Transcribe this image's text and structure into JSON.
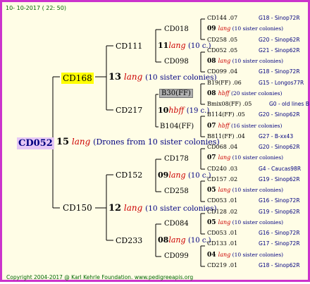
{
  "date": "10- 10-2017 ( 22: 50)",
  "footer": "Copyright 2004-2017 @ Karl Kehrle Foundation.   www.pedigreeapis.org",
  "root": {
    "name": "CD052",
    "num": "15",
    "lang": "lang",
    "info": "(Drones from 10 sister colonies)"
  },
  "gen1": [
    {
      "name": "CD168",
      "num": "13",
      "lang": "lang",
      "info": "(10 sister colonies)"
    },
    {
      "name": "CD150",
      "num": "12",
      "lang": "lang",
      "info": "(10 sister colonies)"
    }
  ],
  "gen2": [
    {
      "name": "CD111",
      "num": "11",
      "lang": "lang",
      "info": "(10 c.)"
    },
    {
      "name": "CD217",
      "num": "10",
      "lang": "hbff",
      "info": "(19 c.)"
    },
    {
      "name": "CD152",
      "num": "09",
      "lang": "lang",
      "info": "(10 c.)"
    },
    {
      "name": "CD233",
      "num": "08",
      "lang": "lang",
      "info": "(10 c.)"
    }
  ],
  "gen3": [
    {
      "name": "CD018"
    },
    {
      "name": "CD098"
    },
    {
      "name": "B30(FF)"
    },
    {
      "name": "B104(FF)"
    },
    {
      "name": "CD178"
    },
    {
      "name": "CD258"
    },
    {
      "name": "CD084"
    },
    {
      "name": "CD099"
    }
  ],
  "gen4": [
    {
      "type": "line",
      "name": "CD144",
      "num": ".07",
      "ref": "G18 - Sinop72R"
    },
    {
      "type": "note",
      "num": "09",
      "lang": "lang",
      "info": "(10 sister colonies)"
    },
    {
      "type": "line",
      "name": "CD258",
      "num": ".05",
      "ref": "G20 - Sinop62R"
    },
    {
      "type": "line",
      "name": "CD052",
      "num": ".05",
      "ref": "G21 - Sinop62R"
    },
    {
      "type": "note",
      "num": "08",
      "lang": "lang",
      "info": "(10 sister colonies)"
    },
    {
      "type": "line",
      "name": "CD099",
      "num": ".04",
      "ref": "G18 - Sinop72R"
    },
    {
      "type": "line",
      "name": "B19(FF)",
      "num": ".06",
      "ref": "G15 - Longos77R"
    },
    {
      "type": "note",
      "num": "08",
      "lang": "hbff",
      "info": "(20 sister colonies)"
    },
    {
      "type": "line",
      "name": "Bmix08(FF)",
      "num": ".05",
      "ref": "G0 - old lines B"
    },
    {
      "type": "line",
      "name": "B114(FF)",
      "num": ".05",
      "ref": "G20 - Sinop62R"
    },
    {
      "type": "note",
      "num": "07",
      "lang": "hbff",
      "info": "(16 sister colonies)"
    },
    {
      "type": "line",
      "name": "B811(FF)",
      "num": ".04",
      "ref": "G27 - B-xx43"
    },
    {
      "type": "line",
      "name": "CD068",
      "num": ".04",
      "ref": "G20 - Sinop62R"
    },
    {
      "type": "note",
      "num": "07",
      "lang": "lang",
      "info": "(10 sister colonies)"
    },
    {
      "type": "line",
      "name": "CD240",
      "num": ".03",
      "ref": "G4 - Caucas98R"
    },
    {
      "type": "line",
      "name": "CD157",
      "num": ".02",
      "ref": "G19 - Sinop62R"
    },
    {
      "type": "note",
      "num": "05",
      "lang": "lang",
      "info": "(10 sister colonies)"
    },
    {
      "type": "line",
      "name": "CD053",
      "num": ".01",
      "ref": "G16 - Sinop72R"
    },
    {
      "type": "line",
      "name": "CD128",
      "num": ".02",
      "ref": "G19 - Sinop62R"
    },
    {
      "type": "note",
      "num": "05",
      "lang": "lang",
      "info": "(10 sister colonies)"
    },
    {
      "type": "line",
      "name": "CD053",
      "num": ".01",
      "ref": "G16 - Sinop72R"
    },
    {
      "type": "line",
      "name": "CD133",
      "num": ".01",
      "ref": "G17 - Sinop72R"
    },
    {
      "type": "note",
      "num": "04",
      "lang": "lang",
      "info": "(10 sister colonies)"
    },
    {
      "type": "line",
      "name": "CD219",
      "num": ".01",
      "ref": "G18 - Sinop62R"
    }
  ],
  "colors": {
    "border": "#cc33cc",
    "background": "#fffde6",
    "lang": "#cc0000",
    "info": "#000080",
    "highlight": "#ffff00",
    "root_bg": "#e6c8f5"
  }
}
